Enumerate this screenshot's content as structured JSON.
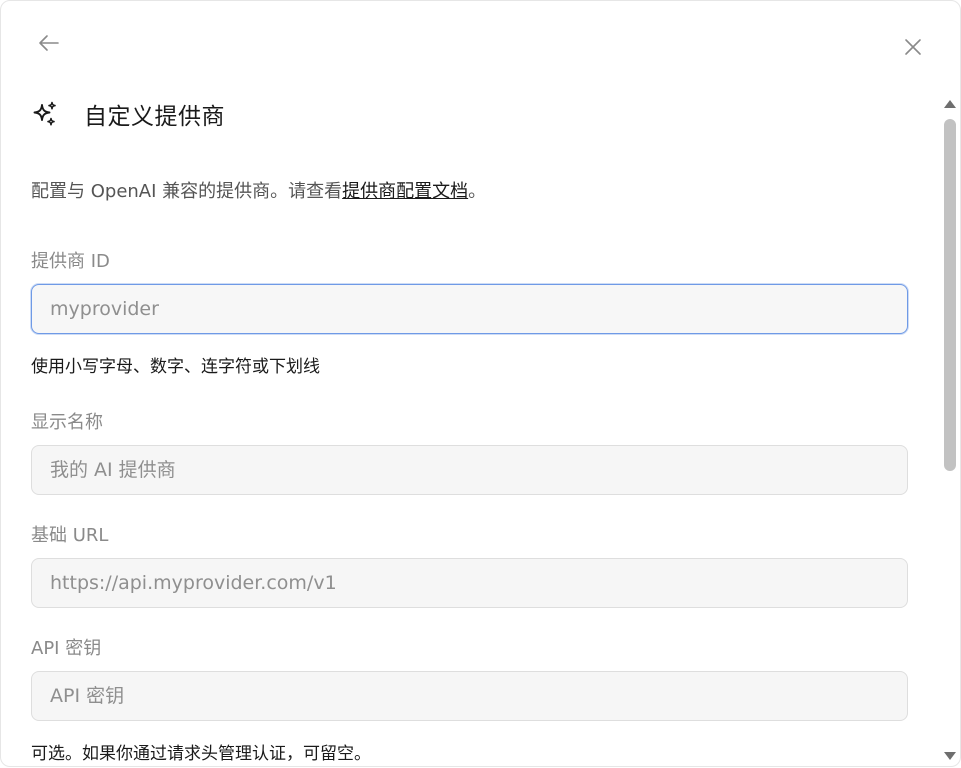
{
  "header": {
    "back_icon": "arrow-left-icon",
    "close_icon": "close-icon",
    "title": "自定义提供商",
    "title_icon": "sparkles-icon"
  },
  "description": {
    "prefix": "配置与 OpenAI 兼容的提供商。请查看",
    "link": "提供商配置文档",
    "suffix": "。"
  },
  "fields": {
    "provider_id": {
      "label": "提供商 ID",
      "placeholder": "myprovider",
      "value": "",
      "hint": "使用小写字母、数字、连字符或下划线"
    },
    "display_name": {
      "label": "显示名称",
      "placeholder": "我的 AI 提供商",
      "value": ""
    },
    "base_url": {
      "label": "基础 URL",
      "placeholder": "https://api.myprovider.com/v1",
      "value": ""
    },
    "api_key": {
      "label": "API 密钥",
      "placeholder": "API 密钥",
      "value": "",
      "hint": "可选。如果你通过请求头管理认证，可留空。"
    }
  },
  "colors": {
    "focus_border": "#6f9ae6",
    "input_bg": "#f6f6f6",
    "label": "#8a8a8a",
    "scroll_thumb": "#c2c2c2"
  }
}
